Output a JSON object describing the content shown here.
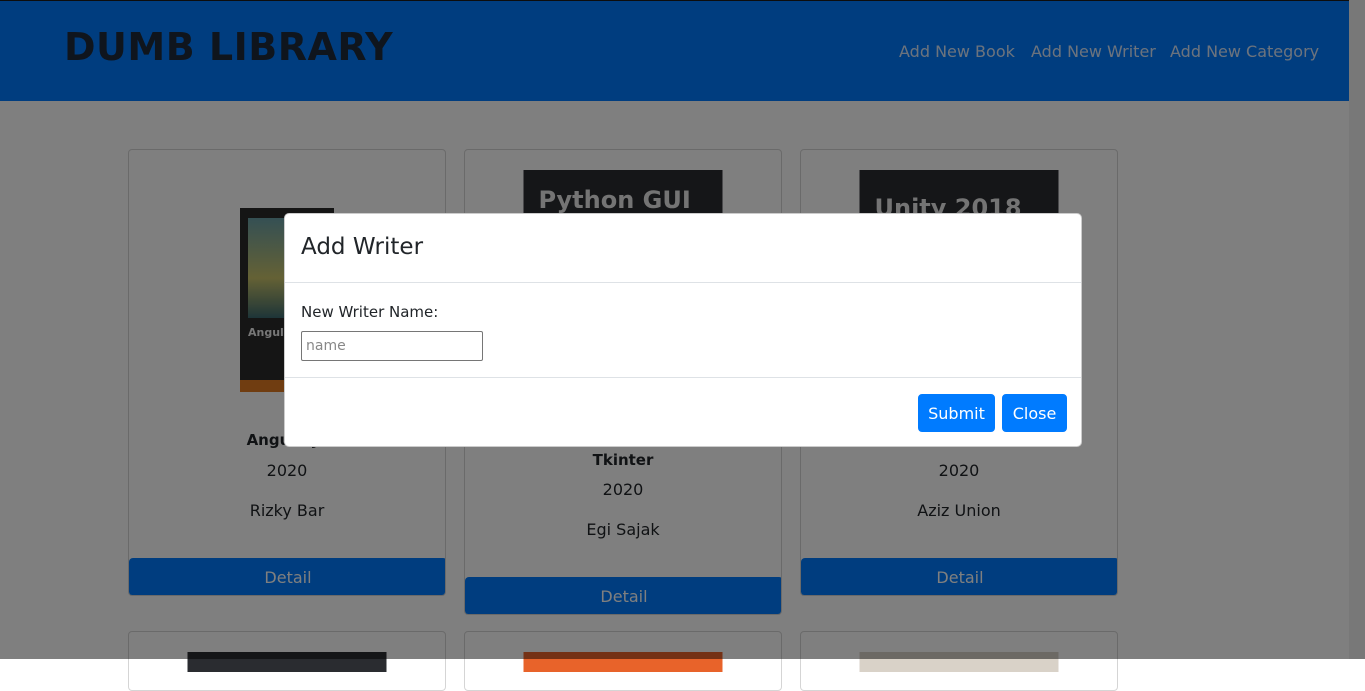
{
  "navbar": {
    "brand": "DUMB LIBRARY",
    "links": [
      "Add New Book",
      "Add New Writer",
      "Add New Category"
    ]
  },
  "cards": [
    {
      "title": "AngularJs",
      "year": "2020",
      "writer": "Rizky Bar",
      "detail": "Detail",
      "cover_text": "AngularJS"
    },
    {
      "title": "Tkinter",
      "year": "2020",
      "writer": "Egi Sajak",
      "detail": "Detail",
      "cover_text": "Python GUI"
    },
    {
      "title": "",
      "year": "2020",
      "writer": "Aziz Union",
      "detail": "Detail",
      "cover_text": "Unity 2018"
    }
  ],
  "modal": {
    "title": "Add Writer",
    "label": "New Writer Name:",
    "input_placeholder": "name",
    "submit": "Submit",
    "close": "Close"
  },
  "colors": {
    "primary": "#007bff",
    "backdrop": "rgba(0,0,0,0.5)"
  }
}
